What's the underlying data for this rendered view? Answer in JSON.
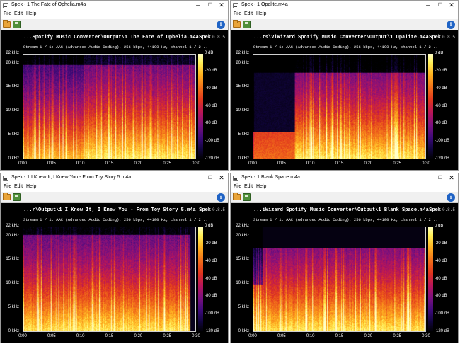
{
  "app": {
    "name": "Spek",
    "version": "0.8.5"
  },
  "menu": {
    "file": "File",
    "edit": "Edit",
    "help": "Help"
  },
  "window_buttons": {
    "minimize": "─",
    "maximize": "☐",
    "close": "✕"
  },
  "toolbar": {
    "open_icon": "folder-open-icon",
    "save_icon": "save-icon",
    "info_icon": "info-icon",
    "info_glyph": "i"
  },
  "stream_info": "Stream 1 / 1: AAC (Advanced Audio Coding), 256 kbps, 44100 Hz, channel 1 / 2...",
  "y_ticks": [
    "22 kHz",
    "20 kHz",
    "15 kHz",
    "10 kHz",
    "5 kHz",
    "0 kHz"
  ],
  "x_ticks": [
    "0:00",
    "0:05",
    "0:10",
    "0:15",
    "0:20",
    "0:25",
    "0:30"
  ],
  "db_ticks": [
    "0 dB",
    "-20 dB",
    "-40 dB",
    "-60 dB",
    "-80 dB",
    "-100 dB",
    "-120 dB"
  ],
  "colors": {
    "colormap": [
      "#000000",
      "#120540",
      "#3c0a78",
      "#7a1080",
      "#b8155a",
      "#e0351e",
      "#f2701a",
      "#ffb01f",
      "#fff25a",
      "#ffffc8"
    ]
  },
  "windows": [
    {
      "title": "Spek - 1 The Fate of Ophelia.m4a",
      "file_label": "...Spotify Music Converter\\Output\\1 The Fate of Ophelia.m4a"
    },
    {
      "title": "Spek - 1 Opalite.m4a",
      "file_label": "...ts\\ViWizard Spotify Music Converter\\Output\\1 Opalite.m4a"
    },
    {
      "title": "Spek - 1 I Knew It, I Knew You - From  Toy Story 5.m4a",
      "file_label": "...r\\Output\\1 I Knew It, I Knew You - From  Toy Story 5.m4a"
    },
    {
      "title": "Spek - 1 Blank Space.m4a",
      "file_label": "...iWizard Spotify Music Converter\\Output\\1 Blank Space.m4a"
    }
  ]
}
